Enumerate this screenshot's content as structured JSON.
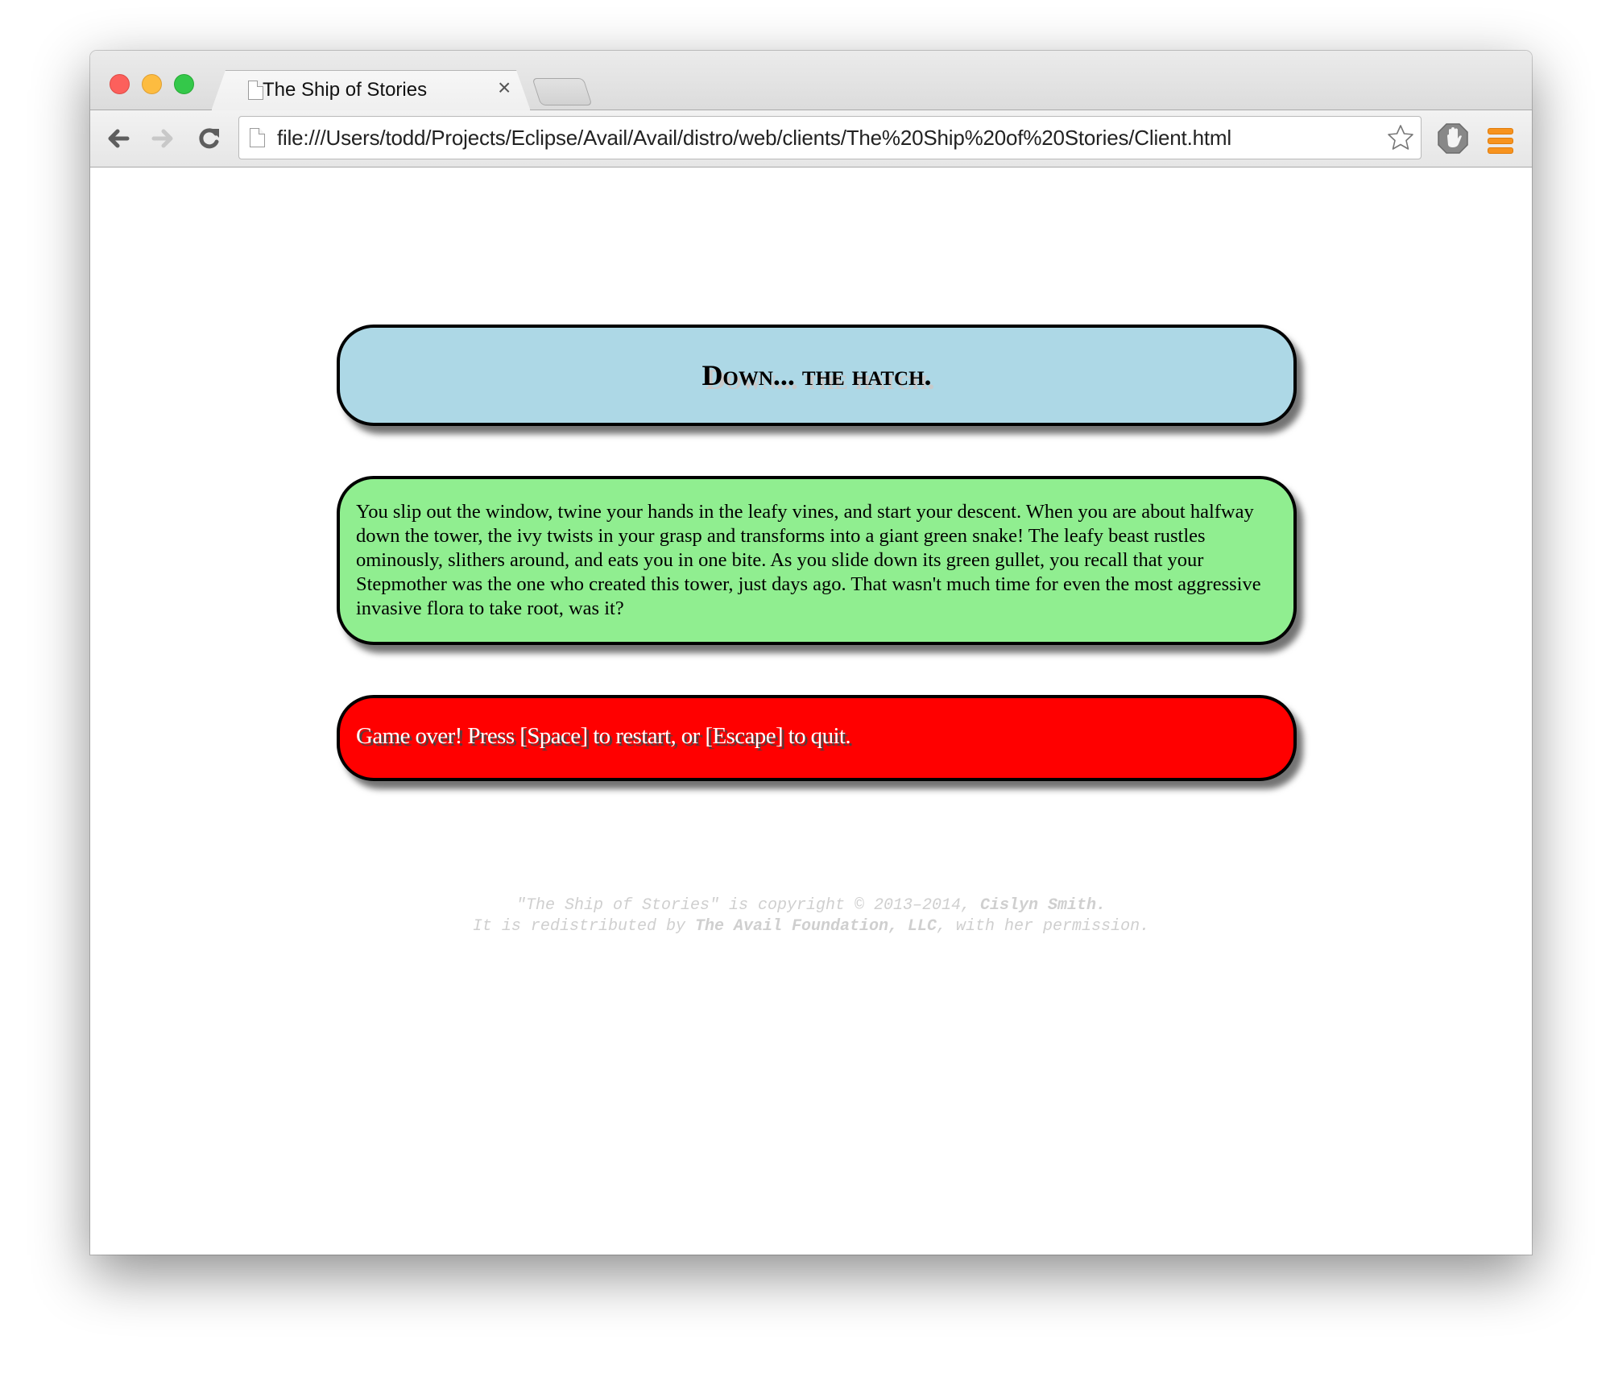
{
  "browser": {
    "tab": {
      "title": "The Ship of Stories",
      "close_glyph": "×",
      "icon": "document-icon"
    },
    "new_tab_icon": "new-tab-icon",
    "nav": {
      "back_icon": "back-arrow-icon",
      "forward_icon": "forward-arrow-icon",
      "reload_icon": "reload-icon",
      "back_enabled": true,
      "forward_enabled": false
    },
    "address_bar": {
      "url": "file:///Users/todd/Projects/Eclipse/Avail/Avail/distro/web/clients/The%20Ship%20of%20Stories/Client.html",
      "page_icon": "document-icon",
      "bookmark_icon": "star-icon"
    },
    "extension_icon": "adblock-hand-icon",
    "menu_icon": "hamburger-menu-icon",
    "window_controls": [
      "close",
      "minimize",
      "zoom"
    ]
  },
  "page": {
    "heading": "Down... the hatch.",
    "story": "You slip out the window, twine your hands in the leafy vines, and start your descent. When you are about halfway down the tower, the ivy twists in your grasp and transforms into a giant green snake! The leafy beast rustles ominously, slithers around, and eats you in one bite. As you slide down its green gullet, you recall that your Stepmother was the one who created this tower, just days ago. That wasn't much time for even the most aggressive invasive flora to take root, was it?",
    "status": "Game over! Press [Space] to restart, or [Escape] to quit.",
    "colors": {
      "heading_bg": "#add8e6",
      "story_bg": "#90ee90",
      "status_bg": "#ff0000",
      "footer_text": "#cfcfcf",
      "menu_accent": "#f7931e"
    },
    "footer": {
      "line1_prefix": "\"The Ship of Stories\" is copyright © 2013–2014, ",
      "line1_author": "Cislyn Smith.",
      "line2_prefix": "It is redistributed by ",
      "line2_org": "The Avail Foundation, LLC",
      "line2_suffix": ", with her permission."
    }
  }
}
